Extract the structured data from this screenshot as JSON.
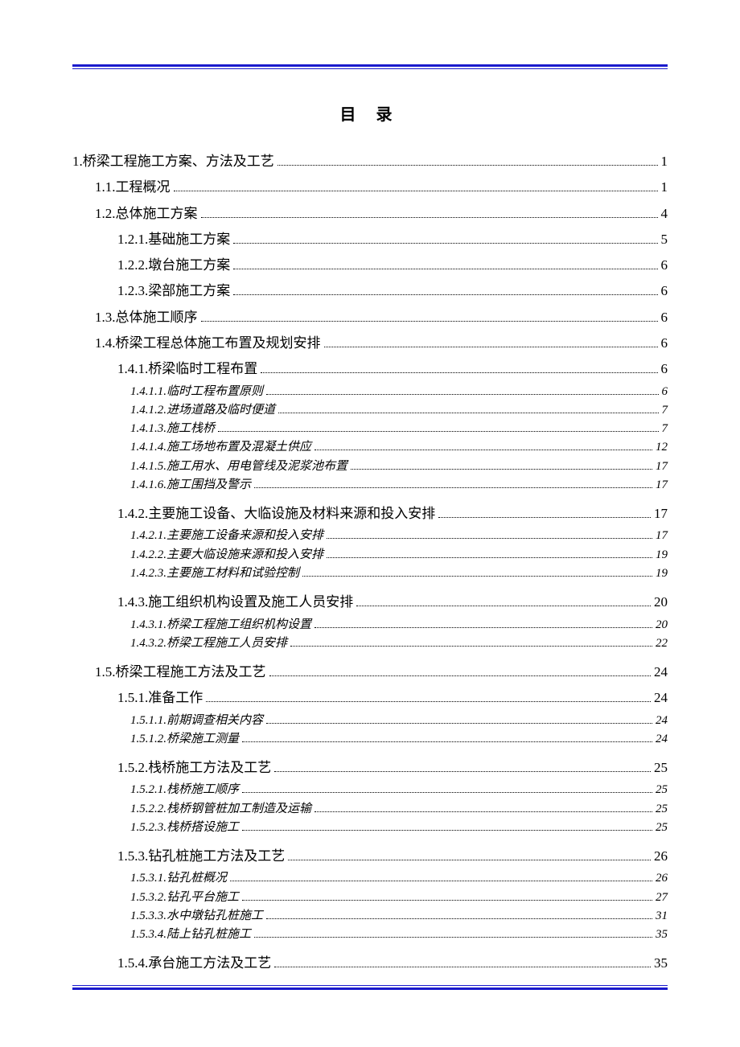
{
  "title": "目 录",
  "entries": [
    {
      "level": 1,
      "label": "1.桥梁工程施工方案、方法及工艺",
      "page": "1"
    },
    {
      "level": 2,
      "label": "1.1.工程概况",
      "page": "1"
    },
    {
      "level": 2,
      "label": "1.2.总体施工方案",
      "page": "4"
    },
    {
      "level": 3,
      "label": "1.2.1.基础施工方案",
      "page": "5"
    },
    {
      "level": 3,
      "label": "1.2.2.墩台施工方案",
      "page": "6"
    },
    {
      "level": 3,
      "label": "1.2.3.梁部施工方案",
      "page": "6"
    },
    {
      "level": 2,
      "label": "1.3.总体施工顺序",
      "page": "6"
    },
    {
      "level": 2,
      "label": "1.4.桥梁工程总体施工布置及规划安排",
      "page": "6"
    },
    {
      "level": 3,
      "label": "1.4.1.桥梁临时工程布置",
      "page": "6"
    },
    {
      "level": 4,
      "label": "1.4.1.1.临时工程布置原则",
      "page": "6"
    },
    {
      "level": 4,
      "label": "1.4.1.2.进场道路及临时便道",
      "page": "7"
    },
    {
      "level": 4,
      "label": "1.4.1.3.施工栈桥",
      "page": "7"
    },
    {
      "level": 4,
      "label": "1.4.1.4.施工场地布置及混凝土供应",
      "page": "12"
    },
    {
      "level": 4,
      "label": "1.4.1.5.施工用水、用电管线及泥浆池布置",
      "page": "17"
    },
    {
      "level": 4,
      "label": "1.4.1.6.施工围挡及警示",
      "page": "17"
    },
    {
      "level": 3,
      "label": "1.4.2.主要施工设备、大临设施及材料来源和投入安排",
      "page": "17",
      "gapBefore": true
    },
    {
      "level": 4,
      "label": "1.4.2.1.主要施工设备来源和投入安排",
      "page": "17"
    },
    {
      "level": 4,
      "label": "1.4.2.2.主要大临设施来源和投入安排",
      "page": "19"
    },
    {
      "level": 4,
      "label": "1.4.2.3.主要施工材料和试验控制",
      "page": "19"
    },
    {
      "level": 3,
      "label": "1.4.3.施工组织机构设置及施工人员安排",
      "page": "20",
      "gapBefore": true
    },
    {
      "level": 4,
      "label": "1.4.3.1.桥梁工程施工组织机构设置",
      "page": "20"
    },
    {
      "level": 4,
      "label": "1.4.3.2.桥梁工程施工人员安排",
      "page": "22"
    },
    {
      "level": 2,
      "label": "1.5.桥梁工程施工方法及工艺",
      "page": "24",
      "gapBefore": true
    },
    {
      "level": 3,
      "label": "1.5.1.准备工作",
      "page": "24"
    },
    {
      "level": 4,
      "label": "1.5.1.1.前期调查相关内容",
      "page": "24"
    },
    {
      "level": 4,
      "label": "1.5.1.2.桥梁施工测量",
      "page": "24"
    },
    {
      "level": 3,
      "label": "1.5.2.栈桥施工方法及工艺",
      "page": "25",
      "gapBefore": true
    },
    {
      "level": 4,
      "label": "1.5.2.1.栈桥施工顺序",
      "page": "25"
    },
    {
      "level": 4,
      "label": "1.5.2.2.栈桥钢管桩加工制造及运输",
      "page": "25"
    },
    {
      "level": 4,
      "label": "1.5.2.3.栈桥搭设施工",
      "page": "25"
    },
    {
      "level": 3,
      "label": "1.5.3.钻孔桩施工方法及工艺",
      "page": "26",
      "gapBefore": true
    },
    {
      "level": 4,
      "label": "1.5.3.1.钻孔桩概况",
      "page": "26"
    },
    {
      "level": 4,
      "label": "1.5.3.2.钻孔平台施工",
      "page": "27"
    },
    {
      "level": 4,
      "label": "1.5.3.3.水中墩钻孔桩施工",
      "page": "31"
    },
    {
      "level": 4,
      "label": "1.5.3.4.陆上钻孔桩施工",
      "page": "35"
    },
    {
      "level": 3,
      "label": "1.5.4.承台施工方法及工艺",
      "page": "35",
      "gapBefore": true
    }
  ]
}
